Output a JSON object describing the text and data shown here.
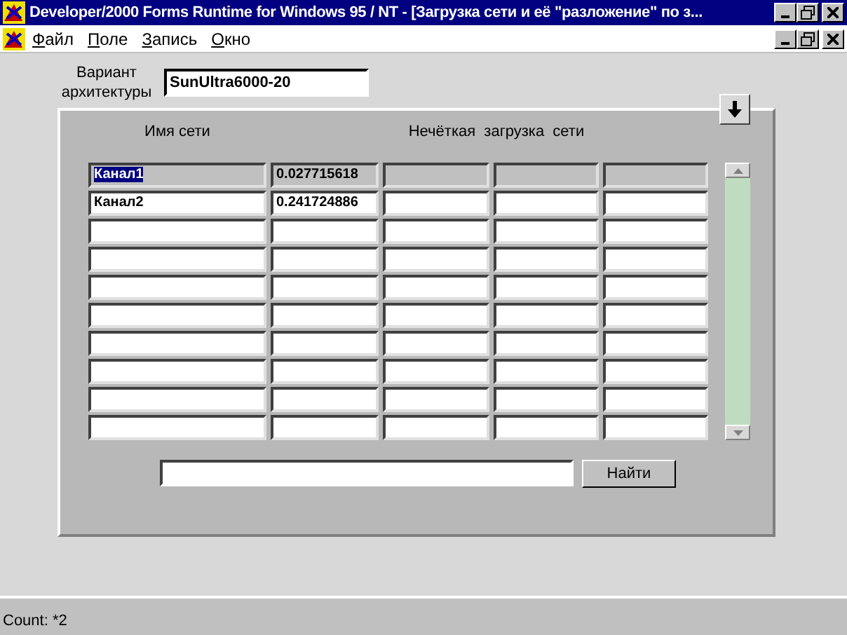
{
  "window": {
    "title": "Developer/2000 Forms Runtime for Windows 95 / NT - [Загрузка сети и её \"разложение\" по з..."
  },
  "menu": [
    {
      "label": "Файл"
    },
    {
      "label": "Поле"
    },
    {
      "label": "Запись"
    },
    {
      "label": "Окно"
    }
  ],
  "architecture": {
    "label": "Вариант архитектуры",
    "value": "SunUltra6000-20"
  },
  "table": {
    "columns": [
      {
        "label": "Имя сети",
        "kind": "single"
      },
      {
        "label": "Нечёткая  загрузка  сети",
        "kind": "wide"
      }
    ],
    "rows": [
      {
        "name": "Канал1",
        "value": "0.027715618",
        "current": true
      },
      {
        "name": "Канал2",
        "value": "0.241724886",
        "current": false
      },
      {
        "current": false
      },
      {
        "current": false
      },
      {
        "current": false
      },
      {
        "current": false
      },
      {
        "current": false
      },
      {
        "current": false
      },
      {
        "current": false
      },
      {
        "current": false
      }
    ]
  },
  "search": {
    "button": "Найти"
  },
  "status_bar": {
    "text": "Count: *2"
  }
}
